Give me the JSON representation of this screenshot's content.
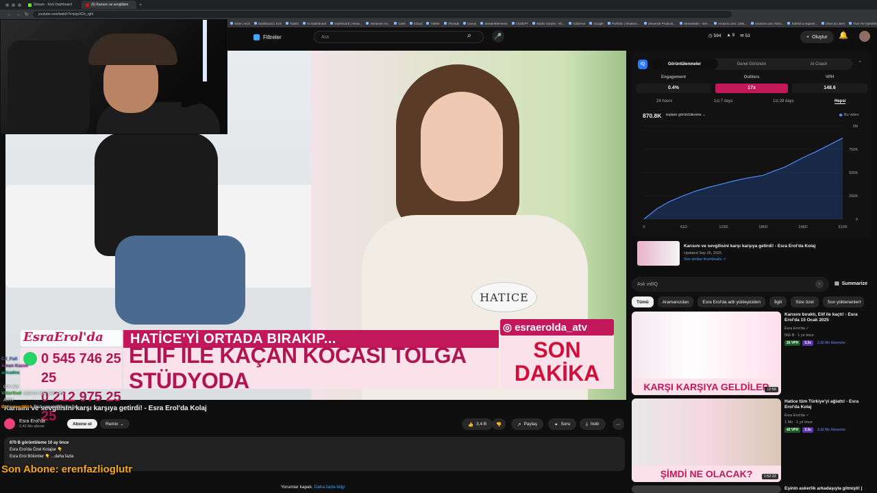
{
  "browser": {
    "tabs": [
      {
        "label": "Stream - Kick Dashboard",
        "color": "#53fc18"
      },
      {
        "label": "(6) Karısını ve sevgilisini",
        "color": "#ff0000"
      }
    ],
    "url": "youtube.com/watch?v=pqvXCb_rghI",
    "bookmarks": [
      "sister | Kick",
      "Dashboard | Kick",
      "Twitch",
      "Yo Dashboard",
      "Dashboard | Strea...",
      "Streamer Ad...",
      "Canlı",
      "iCloud",
      "Twitter",
      "Threads",
      "Oceus",
      "StreamElements",
      "ChatGPT",
      "Radio Garden - Kli...",
      "AdSense",
      "Google",
      "Portfolio | Shutters...",
      "Universal Producti...",
      "Streamlabs - stre...",
      "Amazon.com: USB...",
      "Amazon.com: NOV...",
      "Submit a request...",
      "Drive & Listen",
      "Tüm Yer İşaretleri"
    ]
  },
  "yt_header": {
    "filters_label": "Filtreler",
    "search_placeholder": "Ara",
    "stats": [
      "594",
      "9",
      "53"
    ],
    "create_label": "Oluştur",
    "notif_count": "9+"
  },
  "video": {
    "name_tag": "HATICE",
    "lower_third": {
      "logo": "EsraErol'da",
      "top": "HATİCE'Yİ ORTADA BIRAKIP...",
      "main": "ELİF İLE KAÇAN KOCASI TOLGA STÜDYODA",
      "phones": [
        "0 545 746 25 25",
        "0 212 975 25 25"
      ],
      "handle": "esraerolda_atv",
      "breaking": [
        "SON",
        "DAKİKA"
      ]
    }
  },
  "watch": {
    "title": "Karısını ve sevgilisini karşı karşıya getirdi! - Esra Erol'da Kolaj",
    "channel": "Esra Erol'da",
    "subs": "2,42 Mn abone",
    "subscribe": "Abone ol",
    "remix": "Remix",
    "likes": "3,4 B",
    "share": "Paylaş",
    "ask": "Soru",
    "download": "İndir",
    "desc_meta": "870 B görüntüleme  10 ay önce",
    "desc_line1": "Esra Erol'da Özel Kolajlar 👇",
    "desc_line2": "Esra Erol Bölümler 👇  ...daha fazla",
    "comments_off": "Yorumlar kapalı.",
    "more_info": "Daha fazla bilgi"
  },
  "chat": {
    "messages": [
      {
        "user": "CJ_Fall",
        "text": "",
        "color": "#5c6bc0"
      },
      {
        "user": "Aman Kazım",
        "text": "",
        "color": "#8e44ad"
      },
      {
        "user": "aricadea",
        "text": "",
        "color": "#16a085"
      },
      {
        "user": "",
        "text": "",
        "color": "#9575cd"
      },
      {
        "user": "",
        "text": "çok şey",
        "color": "#e0e0e0"
      },
      {
        "user": "VidarGud",
        "text": "adamin tipe bak amk",
        "color": "#4caf50"
      },
      {
        "user": "",
        "text": "ARTI",
        "color": "#e0e0e0"
      },
      {
        "user": "Bonistay:0914",
        "text": "Pisti sopokkiyasına ge...",
        "color": "#ff9800"
      }
    ],
    "last_sub": "Son Abone: erenfazlioglutr"
  },
  "vidiq": {
    "logo": "IQ",
    "tabs": [
      "Görüntülenmeler",
      "Genel Görünüm",
      "AI Coach"
    ],
    "metrics": [
      {
        "label": "Engagement",
        "value": "0.4%"
      },
      {
        "label": "Outliers",
        "value": "17x"
      },
      {
        "label": "VPH",
        "value": "148.6"
      }
    ],
    "ranges": [
      "24 hours",
      "1st 7 days",
      "1st 28 days",
      "Hepsi"
    ],
    "total": "870.8K",
    "metric_select": "toplam görüntülenme ⌄",
    "legend": "Bu video",
    "current": {
      "title": "Karısını ve sevgilisini karşı karşıya getirdi! - Esra Erol'da Kolaj",
      "updated": "Updated Sep 26, 2025",
      "similar": "See similar thumbnails ↗"
    },
    "ask_placeholder": "Ask vidIQ",
    "summarize": "Summarize"
  },
  "chart_data": {
    "type": "line",
    "x": [
      0,
      20,
      40,
      61,
      80,
      100,
      123,
      140,
      160,
      186,
      200,
      220,
      248,
      270,
      290,
      310
    ],
    "x_ticks": [
      "0",
      "61D",
      "123D",
      "186D",
      "248D",
      "310D"
    ],
    "y_ticks": [
      "0",
      "250K",
      "500K",
      "750K",
      "1M"
    ],
    "series": [
      {
        "name": "Bu video",
        "values": [
          0,
          110000,
          190000,
          250000,
          300000,
          340000,
          380000,
          410000,
          440000,
          470000,
          510000,
          560000,
          660000,
          730000,
          800000,
          870800
        ]
      }
    ],
    "ylim": [
      0,
      1000000
    ],
    "xlim": [
      0,
      310
    ]
  },
  "chips": [
    "Tümü",
    "Aramanızdan",
    "Esra Erol'da adlı yükleyiciden",
    "İlgili",
    "Size özel",
    "Son yüklenenler"
  ],
  "related": [
    {
      "title": "Karısını bıraktı, Elif ile kaçtı! - Esra Erol'da 15 Ocak 2025",
      "channel": "Esra Erol'da ✓",
      "meta": "566 B · 1 yıl önce",
      "vph": "26 VPH",
      "x": "3.3x",
      "subs": "2,42 Mn Aboneler",
      "duration": "12:56",
      "banner": "KARŞI KARŞIYA GELDİLER"
    },
    {
      "title": "Hatice tüm Türkiye'yi ağlattı! - Esra Erol'da Kolaj",
      "channel": "Esra Erol'da ✓",
      "meta": "1 Mn · 1 yıl önce",
      "vph": "42 VPH",
      "x": "3.3x",
      "subs": "2,42 Mn Aboneler",
      "duration": "1:52:22",
      "banner": "ŞİMDİ NE OLACAK?"
    },
    {
      "title": "Eşinin askerlik arkadaşıyla gitmişti! |"
    }
  ]
}
